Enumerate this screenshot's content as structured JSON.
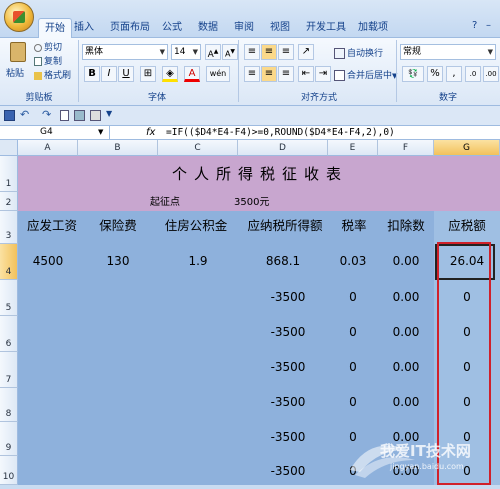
{
  "ribbon": {
    "tabs": [
      "开始",
      "插入",
      "页面布局",
      "公式",
      "数据",
      "审阅",
      "视图",
      "开发工具",
      "加载项"
    ],
    "clipboard": {
      "paste": "粘贴",
      "cut": "剪切",
      "copy": "复制",
      "format_painter": "格式刷",
      "group": "剪贴板"
    },
    "font": {
      "name": "黑体",
      "size": "14",
      "bold": "B",
      "italic": "I",
      "underline": "U",
      "phonetic": "wén",
      "group": "字体"
    },
    "alignment": {
      "wrap": "自动换行",
      "merge": "合并后居中",
      "group": "对齐方式"
    },
    "number": {
      "format": "常规",
      "percent": "%",
      "comma": ",",
      "group": "数字"
    }
  },
  "formula_bar": {
    "name_box": "G4",
    "fx": "fx",
    "formula": "=IF(($D4*E4-F4)>=0,ROUND($D4*E4-F4,2),0)"
  },
  "columns": [
    "A",
    "B",
    "C",
    "D",
    "E",
    "F",
    "G"
  ],
  "rows": [
    "1",
    "2",
    "3",
    "4",
    "5",
    "6",
    "7",
    "8",
    "9",
    "10"
  ],
  "sheet": {
    "title": "个人所得税征收表",
    "threshold_label": "起征点",
    "threshold_value": "3500元",
    "headers": [
      "应发工资",
      "保险费",
      "住房公积金",
      "应纳税所得额",
      "税率",
      "扣除数",
      "应税额"
    ],
    "data": [
      [
        "4500",
        "130",
        "1.9",
        "868.1",
        "0.03",
        "0.00",
        "26.04"
      ],
      [
        "",
        "",
        "",
        "-3500",
        "0",
        "0.00",
        "0"
      ],
      [
        "",
        "",
        "",
        "-3500",
        "0",
        "0.00",
        "0"
      ],
      [
        "",
        "",
        "",
        "-3500",
        "0",
        "0.00",
        "0"
      ],
      [
        "",
        "",
        "",
        "-3500",
        "0",
        "0.00",
        "0"
      ],
      [
        "",
        "",
        "",
        "-3500",
        "0",
        "0.00",
        "0"
      ],
      [
        "",
        "",
        "",
        "-3500",
        "0",
        "0.00",
        "0"
      ]
    ]
  },
  "watermark": {
    "text": "我爱IT技术网",
    "url": "jingyan.baidu.com"
  }
}
